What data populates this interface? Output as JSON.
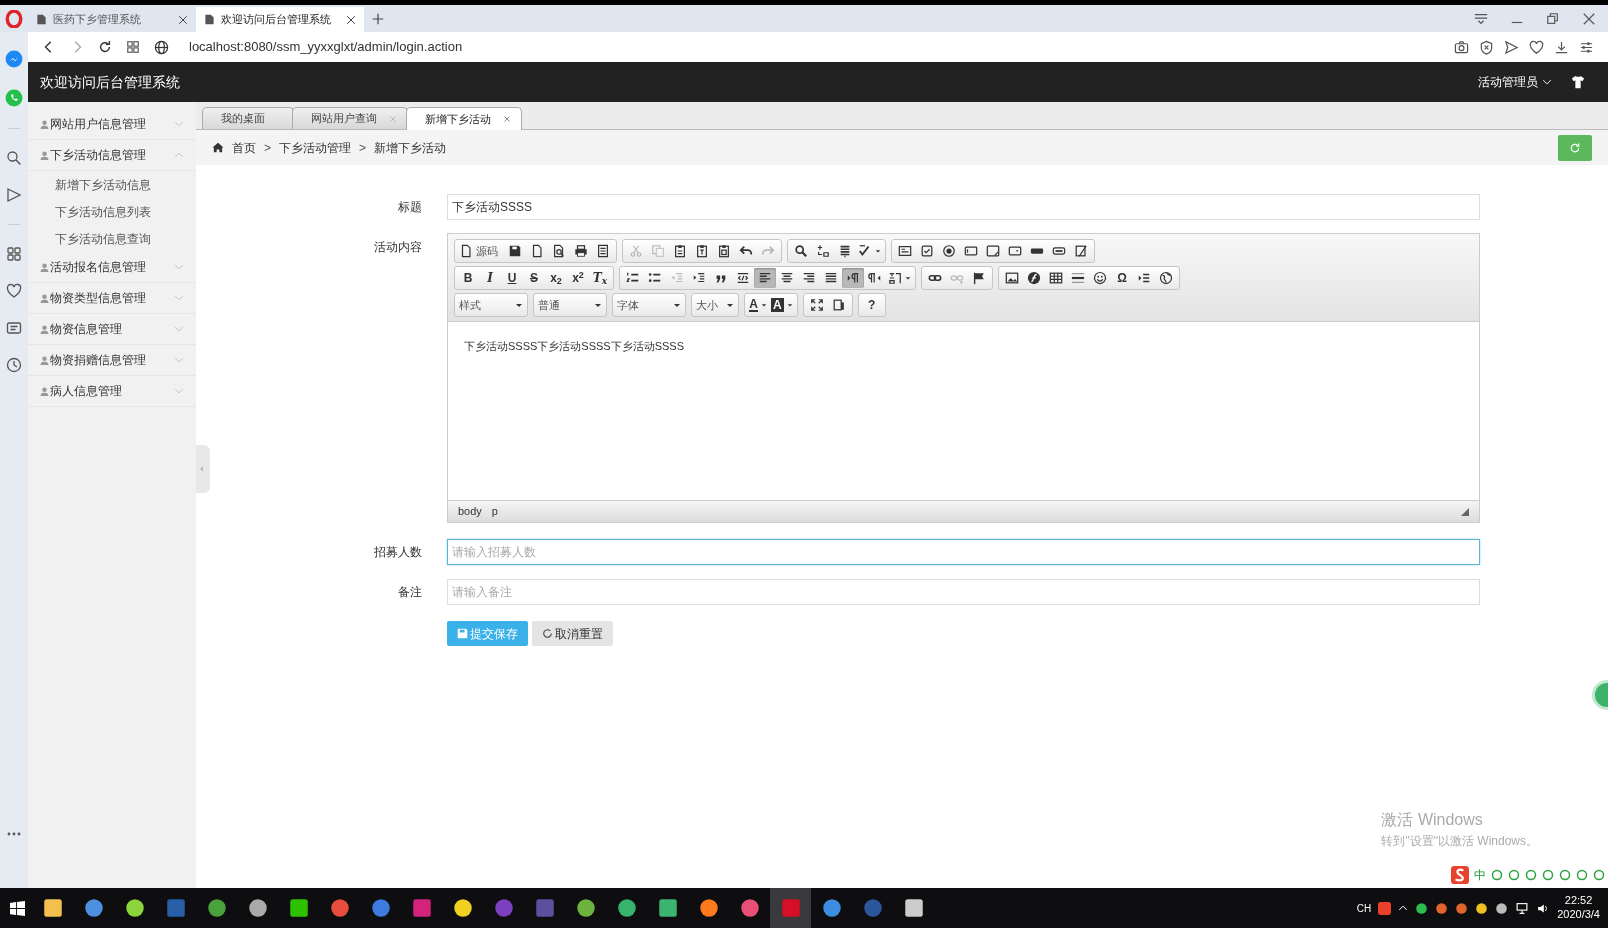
{
  "browser": {
    "tabs": [
      {
        "title": "医药下乡管理系统",
        "selected": false
      },
      {
        "title": "欢迎访问后台管理系统",
        "selected": true
      }
    ],
    "address": "localhost:8080/ssm_yyxxglxt/admin/login.action"
  },
  "header": {
    "title": "欢迎访问后台管理系统",
    "user": "活动管理员"
  },
  "sidebar": {
    "items": [
      {
        "label": "网站用户信息管理",
        "expanded": false
      },
      {
        "label": "下乡活动信息管理",
        "expanded": true,
        "children": [
          {
            "label": "新增下乡活动信息"
          },
          {
            "label": "下乡活动信息列表"
          },
          {
            "label": "下乡活动信息查询"
          }
        ]
      },
      {
        "label": "活动报名信息管理",
        "expanded": false
      },
      {
        "label": "物资类型信息管理",
        "expanded": false
      },
      {
        "label": "物资信息管理",
        "expanded": false
      },
      {
        "label": "物资捐赠信息管理",
        "expanded": false
      },
      {
        "label": "病人信息管理",
        "expanded": false
      }
    ]
  },
  "tabs": [
    {
      "label": "我的桌面",
      "closable": false,
      "selected": false
    },
    {
      "label": "网站用户查询",
      "closable": true,
      "selected": false
    },
    {
      "label": "新增下乡活动",
      "closable": true,
      "selected": true
    }
  ],
  "breadcrumb": [
    {
      "kind": "link",
      "label": "首页"
    },
    {
      "kind": "sep",
      "label": ">"
    },
    {
      "kind": "link",
      "label": "下乡活动管理"
    },
    {
      "kind": "sep",
      "label": ">"
    },
    {
      "kind": "link",
      "label": "新增下乡活动"
    }
  ],
  "form": {
    "title": {
      "label": "标题",
      "value": "下乡活动SSSS"
    },
    "content": {
      "label": "活动内容",
      "text": "下乡活动SSSS下乡活动SSSS下乡活动SSSS",
      "path": [
        "body",
        "p"
      ],
      "toolbar": [
        [
          [
            {
              "kind": "labeled",
              "label": "源码"
            },
            {
              "kind": "icon"
            },
            {
              "kind": "icon"
            },
            {
              "kind": "icon"
            },
            {
              "kind": "icon"
            },
            {
              "kind": "icon"
            }
          ],
          [
            {
              "kind": "icon",
              "disabled": true
            },
            {
              "kind": "icon",
              "disabled": true
            },
            {
              "kind": "icon"
            },
            {
              "kind": "icon"
            },
            {
              "kind": "icon"
            },
            {
              "kind": "icon"
            },
            {
              "kind": "icon",
              "disabled": true
            }
          ],
          [
            {
              "kind": "icon"
            },
            {
              "kind": "icon"
            },
            {
              "kind": "icon"
            },
            {
              "kind": "icon"
            }
          ],
          [
            {
              "kind": "icon"
            },
            {
              "kind": "icon"
            },
            {
              "kind": "icon"
            },
            {
              "kind": "icon"
            },
            {
              "kind": "icon"
            },
            {
              "kind": "icon"
            },
            {
              "kind": "icon"
            },
            {
              "kind": "icon"
            },
            {
              "kind": "icon"
            }
          ]
        ],
        [
          [
            {
              "kind": "glyph",
              "label": "B"
            },
            {
              "kind": "glyph",
              "label": "I"
            },
            {
              "kind": "glyph",
              "label": "U"
            },
            {
              "kind": "glyph",
              "label": "S"
            },
            {
              "kind": "glyph",
              "label": "x$_{2}$"
            },
            {
              "kind": "glyph",
              "label": "x$^{2}$"
            },
            {
              "kind": "glyph",
              "label": "T$_{x}$"
            }
          ],
          [
            {
              "kind": "icon"
            },
            {
              "kind": "icon"
            },
            {
              "kind": "icon",
              "disabled": true
            },
            {
              "kind": "icon"
            },
            {
              "kind": "icon"
            },
            {
              "kind": "icon"
            },
            {
              "kind": "icon",
              "selected": true
            },
            {
              "kind": "icon"
            },
            {
              "kind": "icon"
            },
            {
              "kind": "icon"
            },
            {
              "kind": "icon",
              "selected": true
            },
            {
              "kind": "icon"
            },
            {
              "kind": "icon"
            }
          ],
          [
            {
              "kind": "icon"
            },
            {
              "kind": "icon",
              "disabled": true
            },
            {
              "kind": "icon"
            }
          ],
          [
            {
              "kind": "icon"
            },
            {
              "kind": "icon"
            },
            {
              "kind": "icon"
            },
            {
              "kind": "icon"
            },
            {
              "kind": "icon"
            },
            {
              "kind": "glyph",
              "label": "Ω"
            },
            {
              "kind": "icon"
            },
            {
              "kind": "icon"
            }
          ]
        ],
        [
          [
            {
              "kind": "combo",
              "label": "样式"
            }
          ],
          [
            {
              "kind": "combo",
              "label": "普通"
            }
          ],
          [
            {
              "kind": "combo",
              "label": "字体"
            }
          ],
          [
            {
              "kind": "combo",
              "label": "大小"
            }
          ],
          [
            {
              "kind": "glyph",
              "label": "A"
            },
            {
              "kind": "glyph",
              "label": "A"
            }
          ],
          [
            {
              "kind": "icon"
            },
            {
              "kind": "icon"
            }
          ],
          [
            {
              "kind": "glyph",
              "label": "?"
            }
          ]
        ]
      ]
    },
    "recruit": {
      "label": "招募人数",
      "placeholder": "请输入招募人数",
      "focused": true
    },
    "remark": {
      "label": "备注",
      "placeholder": "请输入备注",
      "focused": false
    },
    "buttons": [
      {
        "kind": "primary",
        "label": "提交保存"
      },
      {
        "kind": "secondary",
        "label": "取消重置"
      }
    ]
  },
  "watermark": {
    "title": "激活 Windows",
    "text": "转到\"设置\"以激活 Windows。"
  },
  "ime": {
    "mode": "中"
  },
  "taskbar": {
    "apps": [
      {
        "selected": false
      },
      {
        "selected": false
      },
      {
        "selected": false
      },
      {
        "selected": false
      },
      {
        "selected": false
      },
      {
        "selected": false
      },
      {
        "selected": false
      },
      {
        "selected": false
      },
      {
        "selected": false
      },
      {
        "selected": false
      },
      {
        "selected": false
      },
      {
        "selected": false
      },
      {
        "selected": false
      },
      {
        "selected": false
      },
      {
        "selected": false
      },
      {
        "selected": false
      },
      {
        "selected": false
      },
      {
        "selected": false
      },
      {
        "selected": true
      },
      {
        "selected": false
      },
      {
        "selected": false
      },
      {
        "selected": false
      }
    ],
    "input_lang": "CH",
    "time": "22:52",
    "date": "2020/3/4"
  }
}
